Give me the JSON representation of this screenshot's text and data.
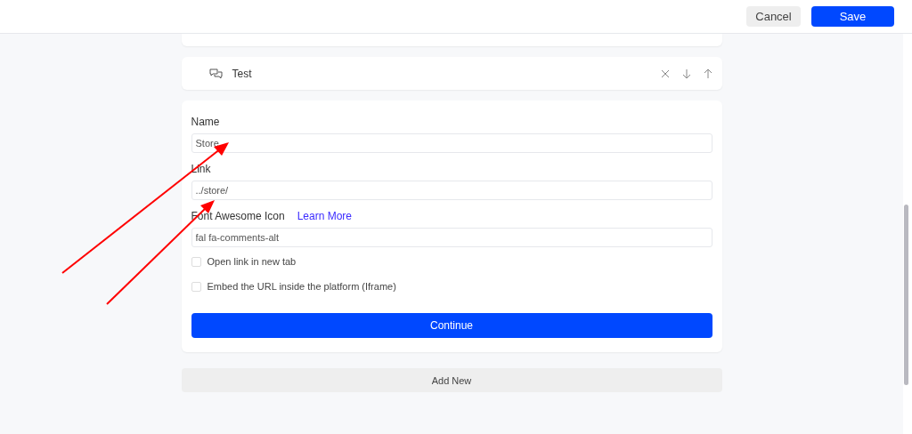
{
  "header": {
    "buttons": [
      {
        "label": "Cancel",
        "kind": "secondary"
      },
      {
        "label": "Save",
        "kind": "primary"
      }
    ]
  },
  "menu_item": {
    "label": "Test",
    "actions": [
      {
        "kind": "remove"
      },
      {
        "kind": "down"
      },
      {
        "kind": "up"
      }
    ]
  },
  "form": {
    "fields": [
      {
        "label": "Name",
        "value": "Store"
      },
      {
        "label": "Link",
        "value": "../store/"
      },
      {
        "label": "Font Awesome Icon",
        "link": "Learn More",
        "value": "fal fa-comments-alt"
      }
    ],
    "checkboxes": [
      {
        "label": "Open link in new tab",
        "checked": false
      },
      {
        "label": "Embed the URL inside the platform (Iframe)",
        "checked": false
      }
    ],
    "submit": "Continue"
  },
  "add_button": "Add New"
}
